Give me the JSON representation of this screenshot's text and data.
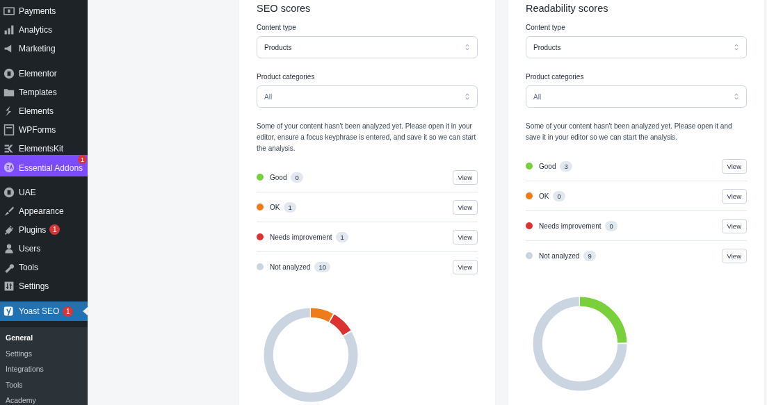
{
  "sidebar": {
    "groups": [
      [
        {
          "label": "Payments",
          "highlighted": false,
          "selected": false
        },
        {
          "label": "Analytics",
          "highlighted": false,
          "selected": false
        },
        {
          "label": "Marketing",
          "highlighted": false,
          "selected": false
        }
      ],
      [
        {
          "label": "Elementor",
          "highlighted": false,
          "selected": false
        },
        {
          "label": "Templates",
          "highlighted": false,
          "selected": false
        },
        {
          "label": "Elements",
          "highlighted": false,
          "selected": false
        },
        {
          "label": "WPForms",
          "highlighted": false,
          "selected": false
        },
        {
          "label": "ElementsKit",
          "highlighted": false,
          "selected": false
        },
        {
          "label": "Essential Addons",
          "badge": "1",
          "highlighted": true,
          "selected": false
        }
      ],
      [
        {
          "label": "UAE",
          "highlighted": false,
          "selected": false
        },
        {
          "label": "Appearance",
          "highlighted": false,
          "selected": false
        },
        {
          "label": "Plugins",
          "badge": "1",
          "highlighted": false,
          "selected": false
        },
        {
          "label": "Users",
          "highlighted": false,
          "selected": false
        },
        {
          "label": "Tools",
          "highlighted": false,
          "selected": false
        },
        {
          "label": "Settings",
          "highlighted": false,
          "selected": false
        }
      ],
      [
        {
          "label": "Yoast SEO",
          "badge": "1",
          "highlighted": false,
          "selected": true
        }
      ]
    ],
    "submenu": [
      {
        "label": "General",
        "selected": true
      },
      {
        "label": "Settings",
        "selected": false
      },
      {
        "label": "Integrations",
        "selected": false
      },
      {
        "label": "Tools",
        "selected": false
      },
      {
        "label": "Academy",
        "selected": false
      }
    ]
  },
  "cards": [
    {
      "title": "SEO scores",
      "fields": [
        {
          "label": "Content type",
          "value": "Products",
          "muted": false
        },
        {
          "label": "Product categories",
          "value": "All",
          "muted": true
        }
      ],
      "notice": "Some of your content hasn't been analyzed yet. Please open it in your editor, ensure a focus keyphrase is entered, and save it so we can start the analysis.",
      "scores": [
        {
          "label": "Good",
          "count": "0",
          "color": "#7ad03a",
          "button": "View"
        },
        {
          "label": "OK",
          "count": "1",
          "color": "#ee7c1b",
          "button": "View"
        },
        {
          "label": "Needs improvement",
          "count": "1",
          "color": "#dc3232",
          "button": "View"
        },
        {
          "label": "Not analyzed",
          "count": "10",
          "color": "#cbd5e1",
          "button": "View"
        }
      ]
    },
    {
      "title": "Readability scores",
      "fields": [
        {
          "label": "Content type",
          "value": "Products",
          "muted": false
        },
        {
          "label": "Product categories",
          "value": "All",
          "muted": true
        }
      ],
      "notice": "Some of your content hasn't been analyzed yet. Please open it and save it in your editor so we can start the analysis.",
      "scores": [
        {
          "label": "Good",
          "count": "3",
          "color": "#7ad03a",
          "button": "View"
        },
        {
          "label": "OK",
          "count": "0",
          "color": "#ee7c1b",
          "button": "View"
        },
        {
          "label": "Needs improvement",
          "count": "0",
          "color": "#dc3232",
          "button": "View"
        },
        {
          "label": "Not analyzed",
          "count": "9",
          "color": "#cbd5e1",
          "button": "View"
        }
      ]
    }
  ]
}
